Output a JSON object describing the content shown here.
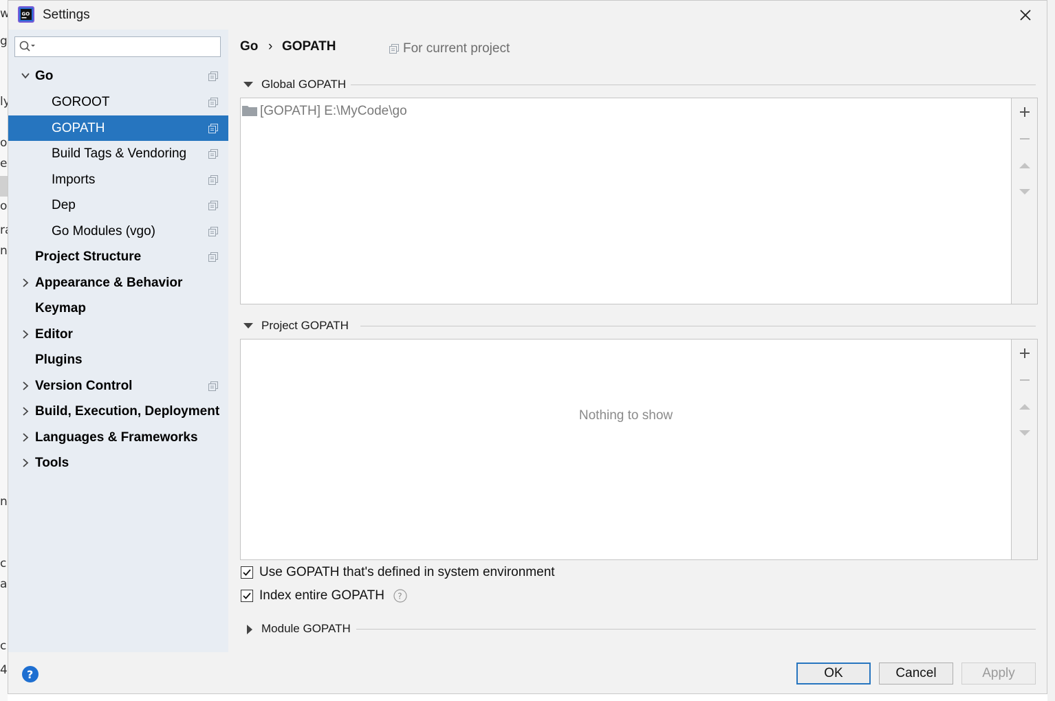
{
  "window": {
    "title": "Settings"
  },
  "search": {
    "placeholder": ""
  },
  "sidebar": {
    "items": [
      {
        "label": "Go",
        "bold": true,
        "expanded": true
      },
      {
        "label": "GOROOT"
      },
      {
        "label": "GOPATH",
        "selected": true
      },
      {
        "label": "Build Tags & Vendoring"
      },
      {
        "label": "Imports"
      },
      {
        "label": "Dep"
      },
      {
        "label": "Go Modules (vgo)"
      },
      {
        "label": "Project Structure",
        "bold": true
      },
      {
        "label": "Appearance & Behavior",
        "bold": true,
        "collapsed": true
      },
      {
        "label": "Keymap",
        "bold": true
      },
      {
        "label": "Editor",
        "bold": true,
        "collapsed": true
      },
      {
        "label": "Plugins",
        "bold": true
      },
      {
        "label": "Version Control",
        "bold": true,
        "collapsed": true
      },
      {
        "label": "Build, Execution, Deployment",
        "bold": true,
        "collapsed": true
      },
      {
        "label": "Languages & Frameworks",
        "bold": true,
        "collapsed": true
      },
      {
        "label": "Tools",
        "bold": true,
        "collapsed": true
      }
    ]
  },
  "breadcrumb": {
    "parent": "Go",
    "separator": "›",
    "current": "GOPATH"
  },
  "scope_label": "For current project",
  "global_gopath": {
    "heading": "Global GOPATH",
    "entries": [
      "[GOPATH] E:\\MyCode\\go"
    ]
  },
  "project_gopath": {
    "heading": "Project GOPATH",
    "empty_text": "Nothing to show"
  },
  "options": {
    "use_system_env": {
      "label": "Use GOPATH that's defined in system environment",
      "checked": true
    },
    "index_entire": {
      "label": "Index entire GOPATH",
      "checked": true
    }
  },
  "module_gopath": {
    "heading": "Module GOPATH"
  },
  "buttons": {
    "ok": "OK",
    "cancel": "Cancel",
    "apply": "Apply"
  },
  "colors": {
    "selection": "#2675bf",
    "sidebar_bg": "#e8edf3",
    "dialog_bg": "#f2f2f2"
  }
}
